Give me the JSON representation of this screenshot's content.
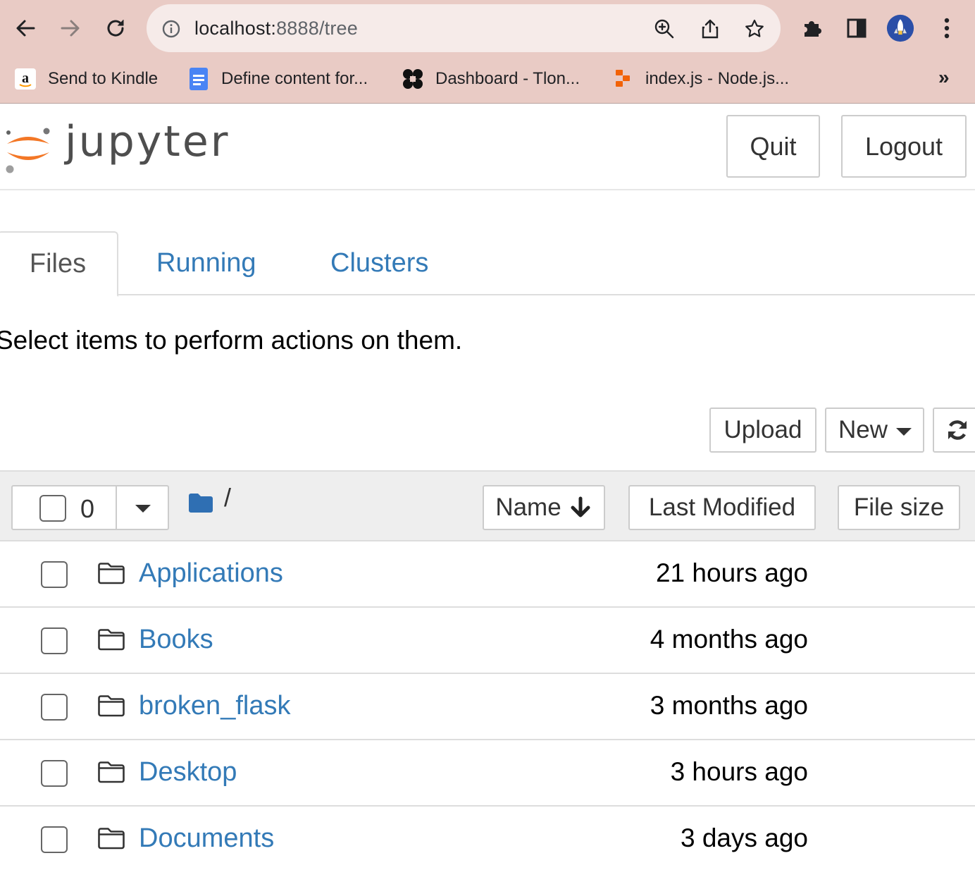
{
  "browser": {
    "url_host": "localhost:",
    "url_rest": "8888/tree",
    "bookmarks": [
      {
        "label": "Send to Kindle",
        "icon": "amazon-icon"
      },
      {
        "label": "Define content for...",
        "icon": "google-docs-icon"
      },
      {
        "label": "Dashboard - Tlon...",
        "icon": "tlon-icon"
      },
      {
        "label": "index.js - Node.js...",
        "icon": "replit-icon"
      }
    ],
    "more_bookmarks": "»"
  },
  "header": {
    "logo_text": "jupyter",
    "quit_label": "Quit",
    "logout_label": "Logout"
  },
  "tabs": [
    {
      "label": "Files",
      "active": true
    },
    {
      "label": "Running",
      "active": false
    },
    {
      "label": "Clusters",
      "active": false
    }
  ],
  "hint": "Select items to perform actions on them.",
  "actions": {
    "upload_label": "Upload",
    "new_label": "New"
  },
  "list_header": {
    "selected_count": "0",
    "breadcrumb_root": "/",
    "sort_name_label": "Name",
    "sort_modified_label": "Last Modified",
    "sort_size_label": "File size"
  },
  "files": [
    {
      "name": "Applications",
      "modified": "21 hours ago"
    },
    {
      "name": "Books",
      "modified": "4 months ago"
    },
    {
      "name": "broken_flask",
      "modified": "3 months ago"
    },
    {
      "name": "Desktop",
      "modified": "3 hours ago"
    },
    {
      "name": "Documents",
      "modified": "3 days ago"
    }
  ],
  "colors": {
    "chrome_background": "#e9cbc5",
    "link_blue": "#337ab7",
    "jupyter_orange": "#f37726"
  }
}
